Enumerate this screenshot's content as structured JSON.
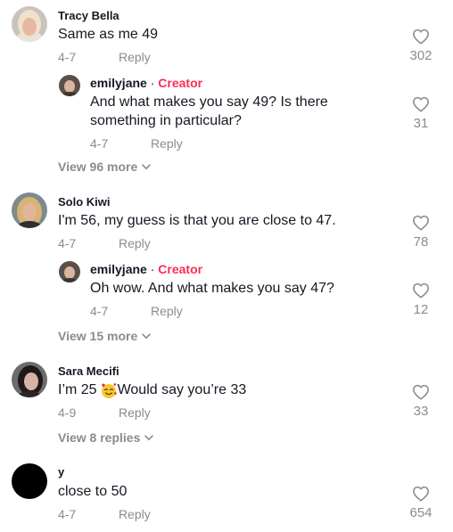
{
  "comments": [
    {
      "name": "Tracy Bella",
      "text": "Same as me 49",
      "date": "4-7",
      "reply": "Reply",
      "likes": "302",
      "reply_item": {
        "name": "emilyjane",
        "dot": " · ",
        "badge": "Creator",
        "text": "And what makes you say 49? Is there something in particular?",
        "date": "4-7",
        "reply": "Reply",
        "likes": "31"
      },
      "view_more": "View 96 more"
    },
    {
      "name": "Solo Kiwi",
      "text": "I'm 56, my guess is that you are close to 47.",
      "date": "4-7",
      "reply": "Reply",
      "likes": "78",
      "reply_item": {
        "name": "emilyjane",
        "dot": " · ",
        "badge": "Creator",
        "text": "Oh wow. And what makes you say 47?",
        "date": "4-7",
        "reply": "Reply",
        "likes": "12"
      },
      "view_more": "View 15 more"
    },
    {
      "name": "Sara Mecifi",
      "text_a": "I’m 25",
      "text_b": " Would say you’re 33",
      "date": "4-9",
      "reply": "Reply",
      "likes": "33",
      "view_more": "View 8 replies"
    },
    {
      "name": "y",
      "text": "close to 50",
      "date": "4-7",
      "reply": "Reply",
      "likes": "654"
    }
  ]
}
